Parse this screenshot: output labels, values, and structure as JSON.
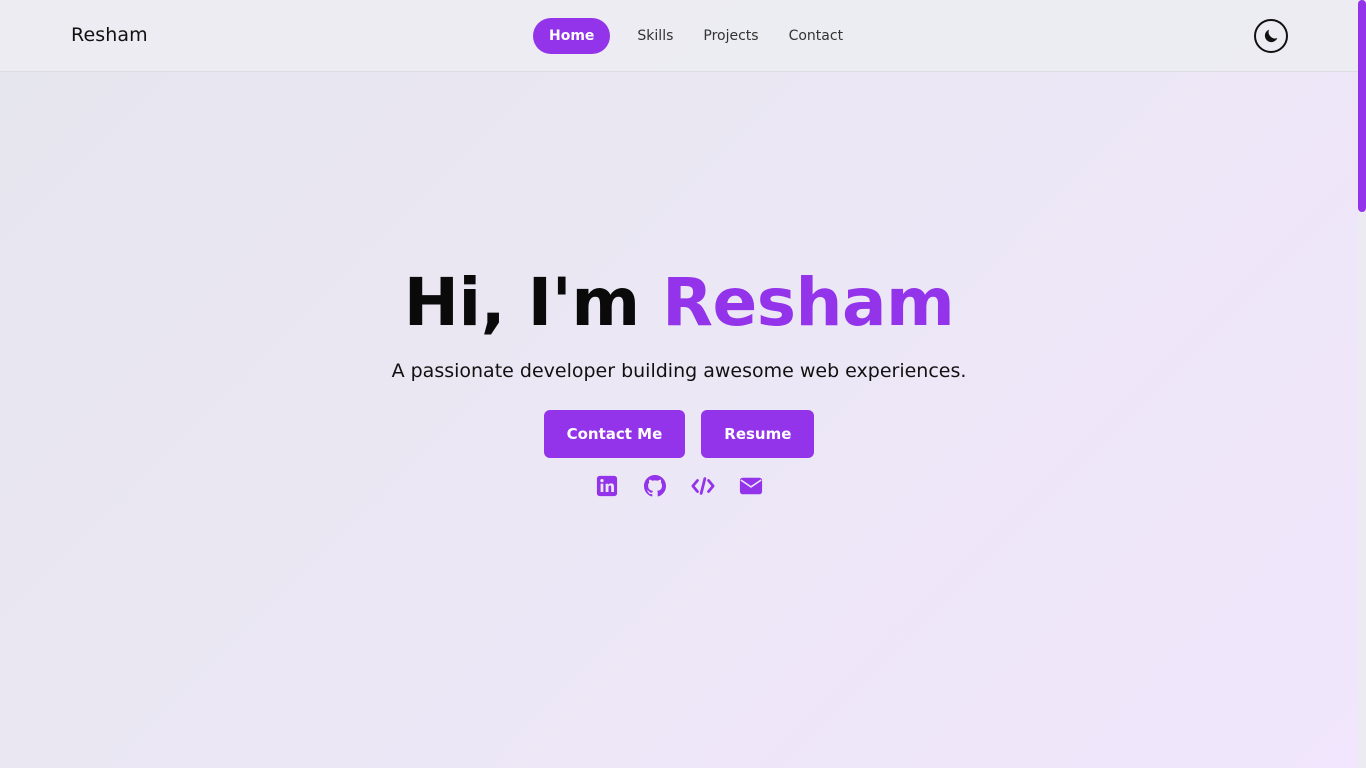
{
  "brand": {
    "name": "Resham"
  },
  "nav": {
    "items": [
      {
        "label": "Home",
        "active": true
      },
      {
        "label": "Skills",
        "active": false
      },
      {
        "label": "Projects",
        "active": false
      },
      {
        "label": "Contact",
        "active": false
      }
    ]
  },
  "theme_toggle": {
    "icon": "moon-icon"
  },
  "hero": {
    "greeting": "Hi, I'm ",
    "name": "Resham",
    "subtitle": "A passionate developer building awesome web experiences."
  },
  "actions": {
    "contact_label": "Contact Me",
    "resume_label": "Resume"
  },
  "socials": [
    {
      "icon": "linkedin-icon"
    },
    {
      "icon": "github-icon"
    },
    {
      "icon": "code-icon"
    },
    {
      "icon": "envelope-icon"
    }
  ],
  "colors": {
    "accent": "#9333ea",
    "text": "#111111"
  }
}
